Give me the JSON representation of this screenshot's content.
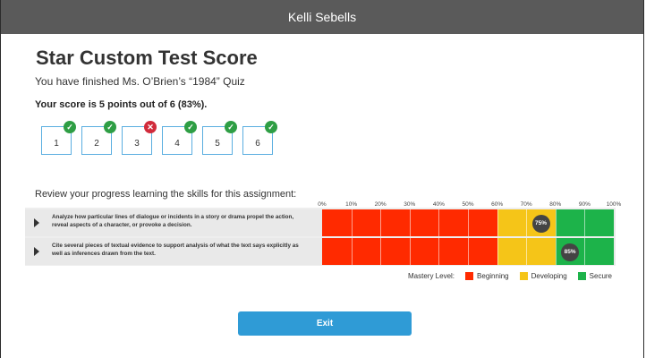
{
  "header": {
    "user_name": "Kelli Sebells"
  },
  "page": {
    "title": "Star Custom Test Score",
    "subtitle": "You have finished Ms. O’Brien’s “1984” Quiz",
    "score_text": "Your score is 5 points out of 6 (83%)."
  },
  "questions": [
    {
      "number": "1",
      "status": "correct",
      "icon": "check-icon"
    },
    {
      "number": "2",
      "status": "correct",
      "icon": "check-icon"
    },
    {
      "number": "3",
      "status": "incorrect",
      "icon": "x-icon"
    },
    {
      "number": "4",
      "status": "correct",
      "icon": "check-icon"
    },
    {
      "number": "5",
      "status": "correct",
      "icon": "check-icon"
    },
    {
      "number": "6",
      "status": "correct",
      "icon": "check-icon"
    }
  ],
  "progress": {
    "intro": "Review your progress learning the skills for this assignment:",
    "scale_labels": [
      "0%",
      "10%",
      "20%",
      "30%",
      "40%",
      "50%",
      "60%",
      "70%",
      "80%",
      "90%",
      "100%"
    ],
    "skills": [
      {
        "text": "Analyze how particular lines of dialogue or incidents in a story or drama propel the action, reveal aspects of a character, or provoke a decision.",
        "score": 75,
        "label": "75%"
      },
      {
        "text": "Cite several pieces of textual evidence to support analysis of what the text says explicitly as well as inferences drawn from the text.",
        "score": 85,
        "label": "85%"
      }
    ],
    "bands": [
      {
        "from": 0,
        "to": 60,
        "color": "#ff2a00"
      },
      {
        "from": 60,
        "to": 80,
        "color": "#f5c518"
      },
      {
        "from": 80,
        "to": 100,
        "color": "#1db34a"
      }
    ],
    "legend": {
      "title": "Mastery Level:",
      "items": [
        {
          "label": "Beginning",
          "color": "#ff2a00"
        },
        {
          "label": "Developing",
          "color": "#f5c518"
        },
        {
          "label": "Secure",
          "color": "#1db34a"
        }
      ]
    }
  },
  "actions": {
    "exit_label": "Exit"
  }
}
